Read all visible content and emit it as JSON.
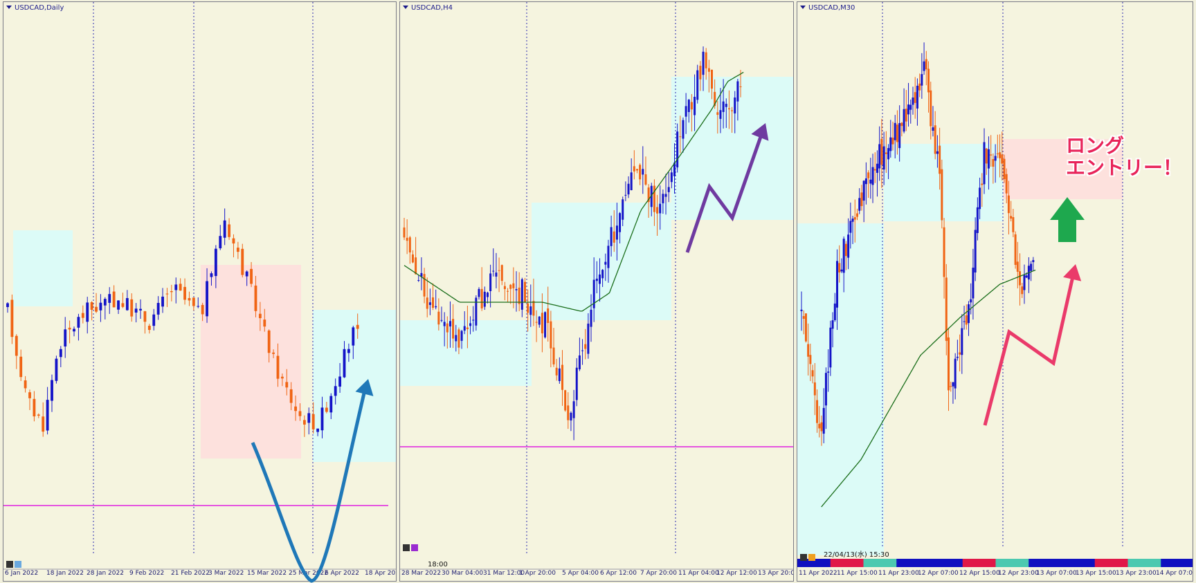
{
  "panels": [
    {
      "title": "USDCAD,Daily",
      "x_labels": [
        "6 Jan 2022",
        "18 Jan 2022",
        "28 Jan 2022",
        "9 Feb 2022",
        "21 Feb 2022",
        "3 Mar 2022",
        "15 Mar 2022",
        "25 Mar 2022",
        "6 Apr 2022",
        "18 Apr 2022"
      ]
    },
    {
      "title": "USDCAD,H4",
      "x_labels": [
        "28 Mar 2022",
        "30 Mar 04:00",
        "31 Mar 12:00",
        "1 Apr 20:00",
        "5 Apr 04:00",
        "6 Apr 12:00",
        "7 Apr 20:00",
        "11 Apr 04:00",
        "12 Apr 12:00",
        "13 Apr 20:00"
      ],
      "status_text": "18:00"
    },
    {
      "title": "USDCAD,M30",
      "x_labels": [
        "11 Apr 2022",
        "11 Apr 15:00",
        "11 Apr 23:00",
        "12 Apr 07:00",
        "12 Apr 15:00",
        "12 Apr 23:00",
        "13 Apr 07:00",
        "13 Apr 15:00",
        "13 Apr 23:00",
        "14 Apr 07:00"
      ],
      "status_text": "22/04/13(水) 15:30"
    }
  ],
  "annotation_text": [
    "ロング",
    "エントリー！"
  ],
  "colors": {
    "bull": "#1414c8",
    "bear": "#f06414",
    "ma": "#1a6e1a",
    "level_line": "#e020e0",
    "zone_blue": "#dcfbf7",
    "zone_pink": "#fde1dd",
    "grid": "#2a2ab0",
    "arrow_blue": "#1f78b8",
    "arrow_purple": "#6f3aa0",
    "arrow_pink": "#ea3a6a",
    "arrow_green": "#1ea84e"
  },
  "chart_data": [
    {
      "type": "candlestick",
      "symbol": "USDCAD",
      "timeframe": "Daily",
      "x": [
        "6 Jan 2022",
        "18 Jan 2022",
        "28 Jan 2022",
        "9 Feb 2022",
        "21 Feb 2022",
        "3 Mar 2022",
        "15 Mar 2022",
        "25 Mar 2022",
        "6 Apr 2022",
        "18 Apr 2022"
      ],
      "series": [
        {
          "values": [
            0.62,
            0.18,
            0.66,
            0.6,
            0.7,
            0.85,
            0.46,
            0.28,
            0.55,
            0.5
          ]
        }
      ],
      "moving_average": false,
      "horizontal_line": true
    },
    {
      "type": "candlestick",
      "symbol": "USDCAD",
      "timeframe": "H4",
      "x": [
        "28 Mar 2022",
        "30 Mar 04:00",
        "31 Mar 12:00",
        "1 Apr 20:00",
        "5 Apr 04:00",
        "6 Apr 12:00",
        "7 Apr 20:00",
        "11 Apr 04:00",
        "12 Apr 12:00",
        "13 Apr 20:00"
      ],
      "series": [
        {
          "values": [
            0.48,
            0.32,
            0.5,
            0.42,
            0.25,
            0.5,
            0.72,
            0.8,
            0.86,
            0.82
          ]
        }
      ],
      "moving_average": true,
      "horizontal_line": true
    },
    {
      "type": "candlestick",
      "symbol": "USDCAD",
      "timeframe": "M30",
      "x": [
        "11 Apr 2022",
        "11 Apr 15:00",
        "11 Apr 23:00",
        "12 Apr 07:00",
        "12 Apr 15:00",
        "12 Apr 23:00",
        "13 Apr 07:00",
        "13 Apr 15:00",
        "13 Apr 23:00",
        "14 Apr 07:00"
      ],
      "series": [
        {
          "values": [
            0.3,
            0.45,
            0.8,
            0.9,
            0.35,
            0.75,
            0.5,
            0.62,
            0.6,
            0.6
          ]
        }
      ],
      "moving_average": true,
      "horizontal_line": false
    }
  ]
}
